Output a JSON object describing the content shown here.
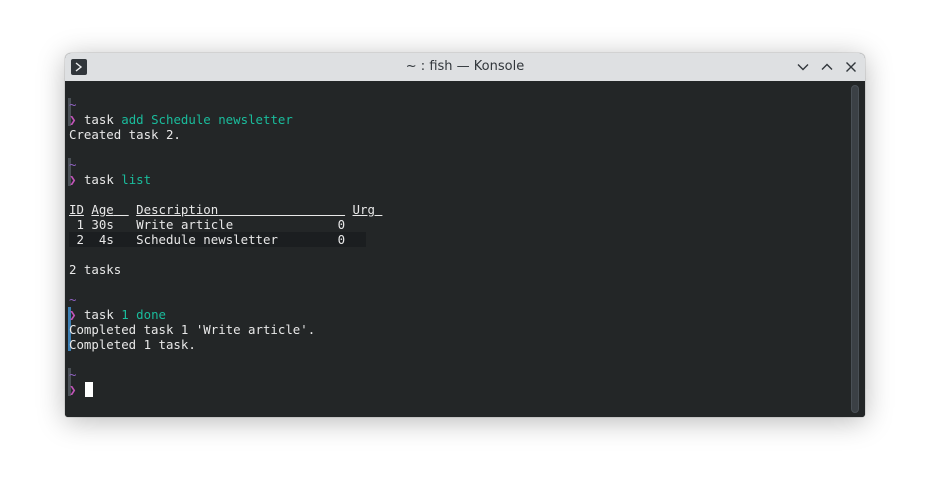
{
  "window": {
    "title": "~ : fish — Konsole",
    "buttons": {
      "minimize_icon": "chevron-down-icon",
      "maximize_icon": "chevron-up-icon",
      "close_icon": "close-icon"
    }
  },
  "terminal": {
    "prompt_tilde": "~",
    "prompt_symbol": "❯",
    "cmd1": {
      "program": "task",
      "args": "add Schedule newsletter",
      "output": "Created task 2."
    },
    "cmd2": {
      "program": "task",
      "args": "list"
    },
    "table": {
      "headers": {
        "id": "ID",
        "age": "Age",
        "description": "Description",
        "urg": "Urg"
      },
      "rows": [
        {
          "id": "1",
          "age": "30s",
          "description": "Write article",
          "urg": "0"
        },
        {
          "id": "2",
          "age": "4s",
          "description": "Schedule newsletter",
          "urg": "0"
        }
      ],
      "summary": "2 tasks"
    },
    "cmd3": {
      "program": "task",
      "args": "1 done",
      "output1": "Completed task 1 'Write article'.",
      "output2": "Completed 1 task."
    }
  },
  "colors": {
    "background": "#232627",
    "prompt": "#c153b8",
    "tilde": "#9061c2",
    "argument": "#1abc9c",
    "text": "#e8e8e8"
  }
}
